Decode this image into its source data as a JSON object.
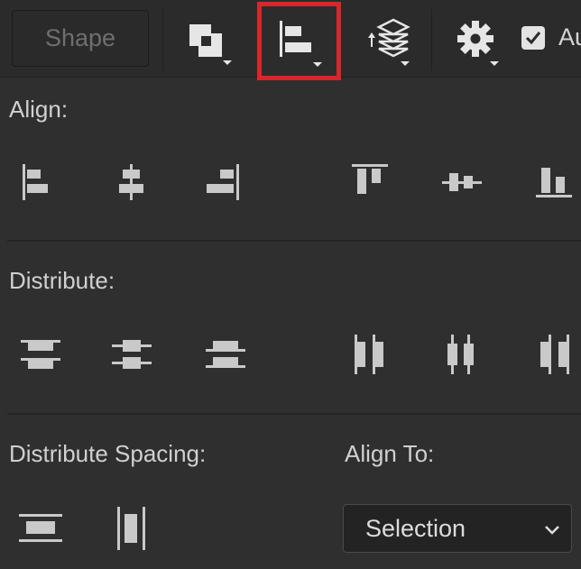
{
  "toolbar": {
    "shape_label": "Shape",
    "auto_label": "Au",
    "icons": [
      "path-operations-icon",
      "path-alignment-icon",
      "path-arrangement-icon",
      "gear-icon"
    ]
  },
  "align": {
    "label": "Align:"
  },
  "distribute": {
    "label": "Distribute:"
  },
  "distribute_spacing": {
    "label": "Distribute Spacing:"
  },
  "align_to": {
    "label": "Align To:",
    "selected": "Selection"
  },
  "colors": {
    "highlight": "#d8262b",
    "background": "#2f2f2f",
    "icon": "#c9c9c9"
  }
}
